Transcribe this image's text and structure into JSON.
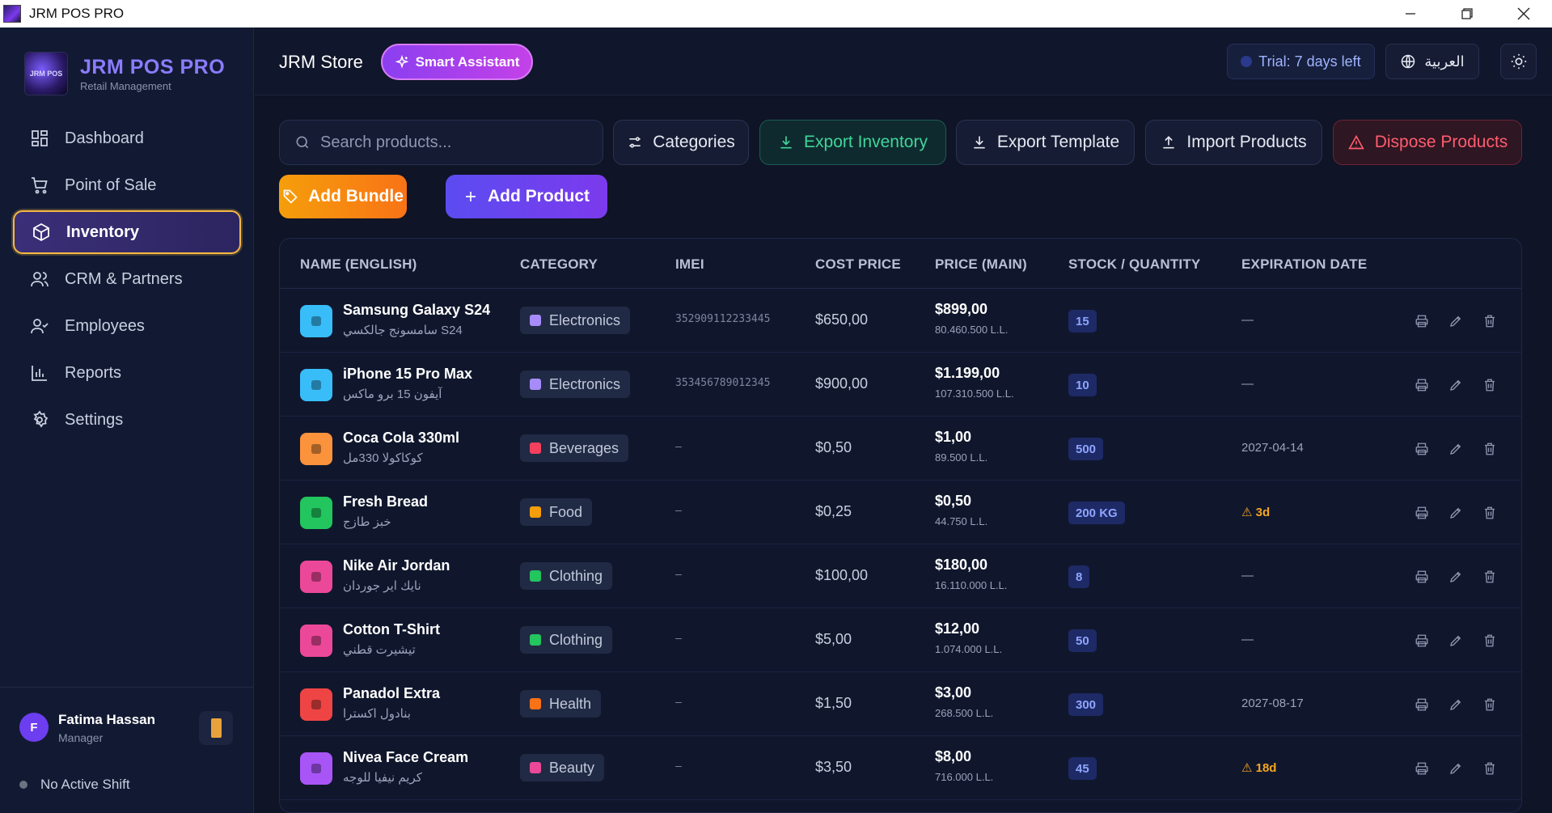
{
  "window": {
    "title": "JRM POS PRO"
  },
  "brand": {
    "name": "JRM POS PRO",
    "subtitle": "Retail Management",
    "logo_text": "JRM POS"
  },
  "nav": {
    "items": [
      {
        "label": "Dashboard",
        "icon": "dashboard-icon"
      },
      {
        "label": "Point of Sale",
        "icon": "cart-icon"
      },
      {
        "label": "Inventory",
        "icon": "box-icon",
        "active": true
      },
      {
        "label": "CRM & Partners",
        "icon": "users-icon"
      },
      {
        "label": "Employees",
        "icon": "user-check-icon"
      },
      {
        "label": "Reports",
        "icon": "bar-chart-icon"
      },
      {
        "label": "Settings",
        "icon": "gear-icon"
      }
    ]
  },
  "user": {
    "initial": "F",
    "name": "Fatima Hassan",
    "role": "Manager",
    "shift_status": "No Active Shift"
  },
  "header": {
    "store_name": "JRM Store",
    "assistant_label": "Smart Assistant",
    "trial_label": "Trial: 7 days left",
    "language_label": "العربية"
  },
  "toolbar": {
    "search_placeholder": "Search products...",
    "categories_label": "Categories",
    "export_inventory_label": "Export Inventory",
    "export_template_label": "Export Template",
    "import_products_label": "Import Products",
    "dispose_products_label": "Dispose Products",
    "add_bundle_label": "Add Bundle",
    "add_product_label": "Add Product"
  },
  "table": {
    "columns": [
      "NAME (ENGLISH)",
      "CATEGORY",
      "IMEI",
      "COST PRICE",
      "PRICE (MAIN)",
      "STOCK / QUANTITY",
      "EXPIRATION DATE"
    ],
    "rows": [
      {
        "name": "Samsung Galaxy S24",
        "name_ar": "سامسونج جالكسي S24",
        "category": "Electronics",
        "imei": "352909112233445",
        "cost": "$650,00",
        "price": "$899,00",
        "price_ll": "80.460.500 L.L.",
        "stock": "15",
        "expiration": "—",
        "exp_warn": false,
        "img_color": "#38bdf8",
        "cat_color": "#a78bfa"
      },
      {
        "name": "iPhone 15 Pro Max",
        "name_ar": "آيفون 15 برو ماكس",
        "category": "Electronics",
        "imei": "353456789012345",
        "cost": "$900,00",
        "price": "$1.199,00",
        "price_ll": "107.310.500 L.L.",
        "stock": "10",
        "expiration": "—",
        "exp_warn": false,
        "img_color": "#38bdf8",
        "cat_color": "#a78bfa"
      },
      {
        "name": "Coca Cola 330ml",
        "name_ar": "كوكاكولا 330مل",
        "category": "Beverages",
        "imei": "–",
        "cost": "$0,50",
        "price": "$1,00",
        "price_ll": "89.500 L.L.",
        "stock": "500",
        "expiration": "2027-04-14",
        "exp_warn": false,
        "img_color": "#fb923c",
        "cat_color": "#f43f5e"
      },
      {
        "name": "Fresh Bread",
        "name_ar": "خبز طازج",
        "category": "Food",
        "imei": "–",
        "cost": "$0,25",
        "price": "$0,50",
        "price_ll": "44.750 L.L.",
        "stock": "200 KG",
        "expiration": "⚠ 3d",
        "exp_warn": true,
        "img_color": "#22c55e",
        "cat_color": "#f59e0b"
      },
      {
        "name": "Nike Air Jordan",
        "name_ar": "نايك اير جوردان",
        "category": "Clothing",
        "imei": "–",
        "cost": "$100,00",
        "price": "$180,00",
        "price_ll": "16.110.000 L.L.",
        "stock": "8",
        "expiration": "—",
        "exp_warn": false,
        "img_color": "#ec4899",
        "cat_color": "#22c55e"
      },
      {
        "name": "Cotton T-Shirt",
        "name_ar": "تيشيرت قطني",
        "category": "Clothing",
        "imei": "–",
        "cost": "$5,00",
        "price": "$12,00",
        "price_ll": "1.074.000 L.L.",
        "stock": "50",
        "expiration": "—",
        "exp_warn": false,
        "img_color": "#ec4899",
        "cat_color": "#22c55e"
      },
      {
        "name": "Panadol Extra",
        "name_ar": "بنادول اكسترا",
        "category": "Health",
        "imei": "–",
        "cost": "$1,50",
        "price": "$3,00",
        "price_ll": "268.500 L.L.",
        "stock": "300",
        "expiration": "2027-08-17",
        "exp_warn": false,
        "img_color": "#ef4444",
        "cat_color": "#f97316"
      },
      {
        "name": "Nivea Face Cream",
        "name_ar": "كريم نيفيا للوجه",
        "category": "Beauty",
        "imei": "–",
        "cost": "$3,50",
        "price": "$8,00",
        "price_ll": "716.000 L.L.",
        "stock": "45",
        "expiration": "⚠ 18d",
        "exp_warn": true,
        "img_color": "#a855f7",
        "cat_color": "#ec4899"
      }
    ]
  }
}
